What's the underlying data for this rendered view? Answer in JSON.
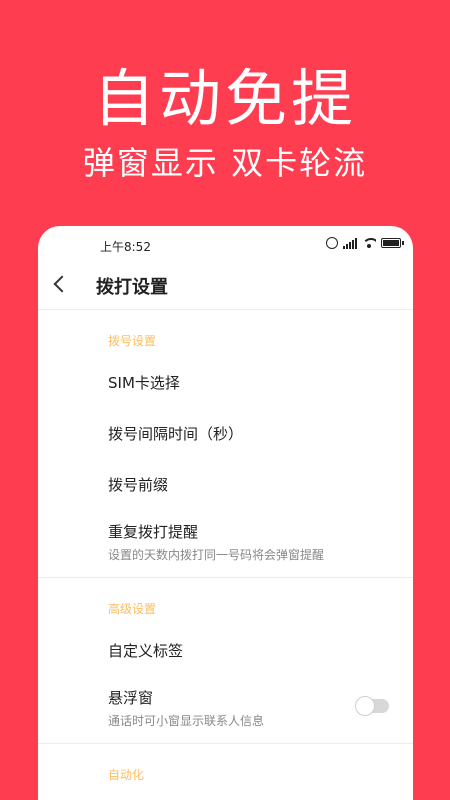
{
  "hero": {
    "title": "自动免提",
    "subtitle": "弹窗显示  双卡轮流"
  },
  "status_bar": {
    "time": "上午8:52"
  },
  "app_bar": {
    "title": "拨打设置"
  },
  "sections": [
    {
      "header": "拨号设置",
      "items": [
        {
          "label": "SIM卡选择"
        },
        {
          "label": "拨号间隔时间（秒）"
        },
        {
          "label": "拨号前缀"
        },
        {
          "label": "重复拨打提醒",
          "sub": "设置的天数内拨打同一号码将会弹窗提醒"
        }
      ]
    },
    {
      "header": "高级设置",
      "items": [
        {
          "label": "自定义标签"
        },
        {
          "label": "悬浮窗",
          "sub": "通话时可小窗显示联系人信息",
          "toggle": false
        }
      ]
    },
    {
      "header": "自动化"
    }
  ],
  "colors": {
    "background": "#ff3d51",
    "section_header": "#ffbd5e"
  }
}
